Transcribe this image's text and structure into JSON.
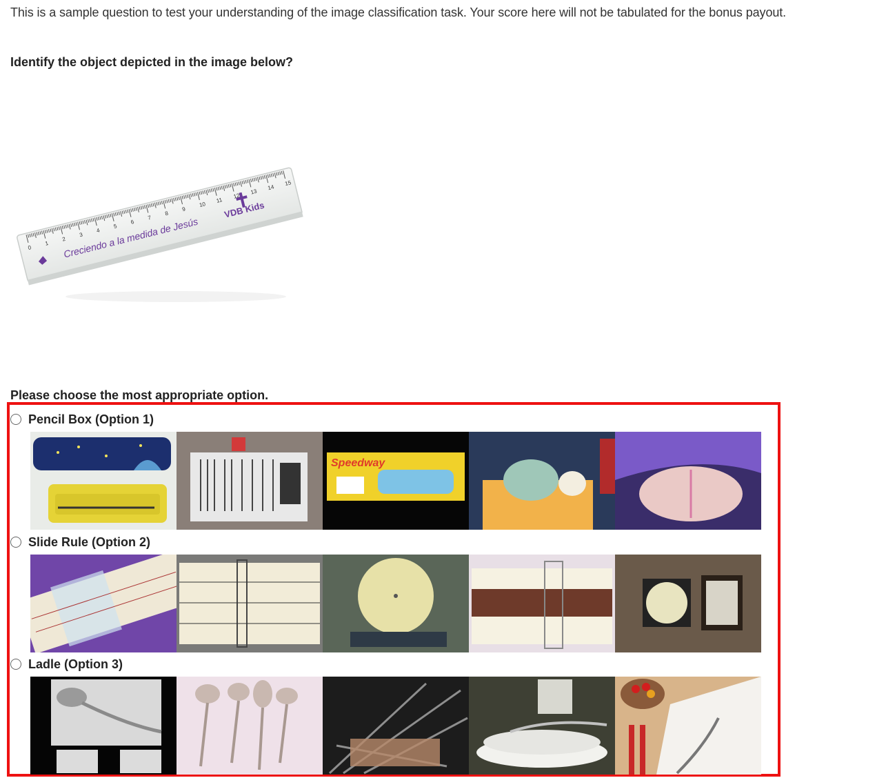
{
  "intro_text": "This is a sample question to test your understanding of the image classification task. Your score here will not be tabulated for the bonus payout.",
  "question": "Identify the object depicted in the image below?",
  "query_image": {
    "ruler_text": "Creciendo a la medida de Jesús",
    "ruler_brand": "VDB Kids",
    "ruler_numbers": [
      "0",
      "1",
      "2",
      "3",
      "4",
      "5",
      "6",
      "7",
      "8",
      "9",
      "10",
      "11",
      "12",
      "13",
      "14",
      "15"
    ]
  },
  "prompt": "Please choose the most appropriate option.",
  "options": [
    {
      "label": "Pencil Box (Option 1)",
      "thumb_text": [
        "",
        "",
        "Speedway",
        "",
        ""
      ]
    },
    {
      "label": "Slide Rule (Option 2)"
    },
    {
      "label": "Ladle (Option 3)"
    }
  ],
  "colors": {
    "highlight": "#ee1111",
    "ruler_ink": "#6a3a9a"
  }
}
